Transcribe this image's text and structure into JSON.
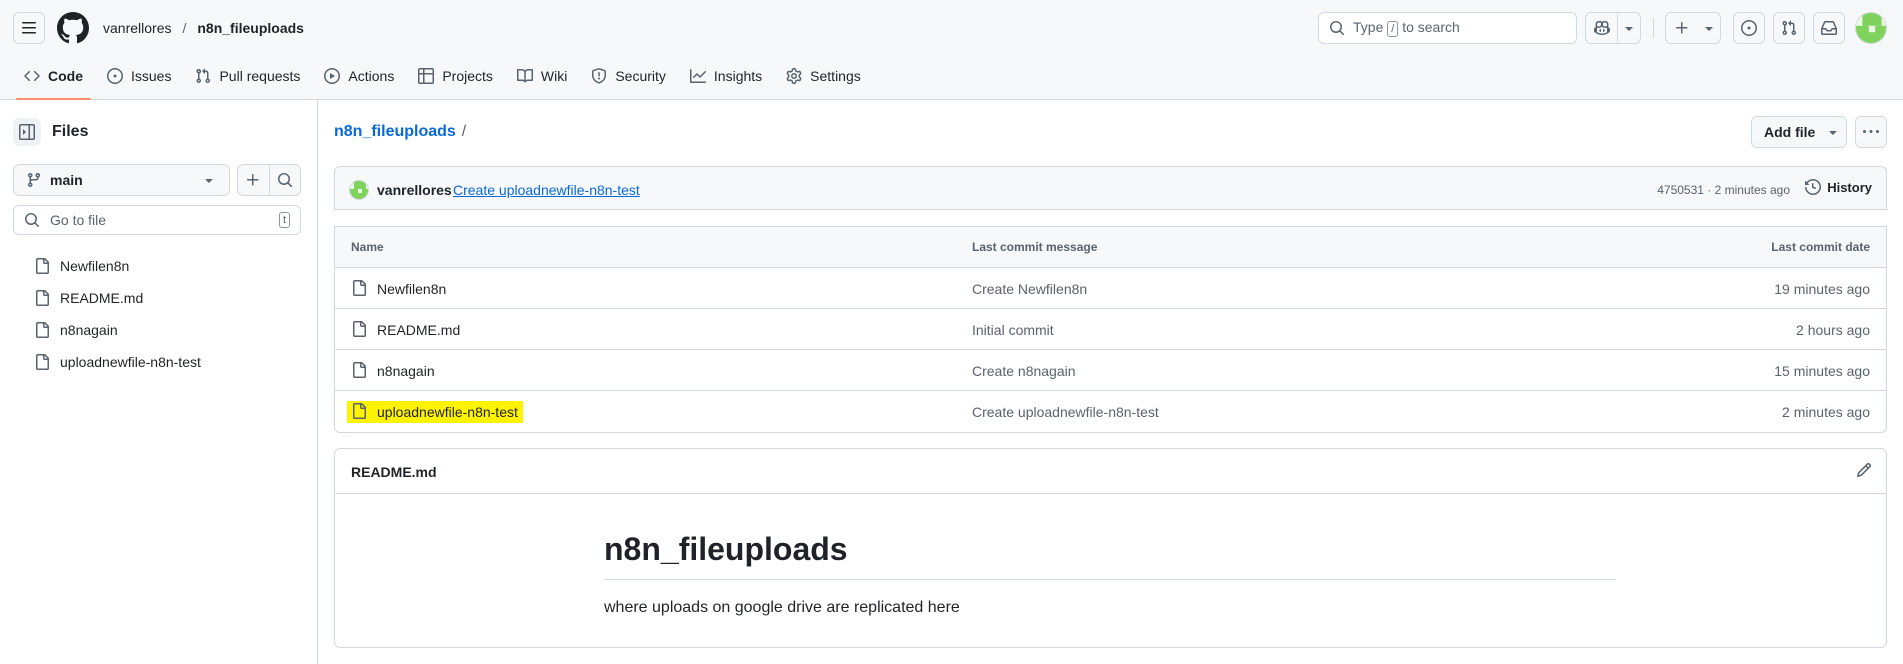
{
  "header": {
    "owner": "vanrellores",
    "separator": "/",
    "repo": "n8n_fileuploads",
    "search": {
      "text_before": "Type",
      "key": "/",
      "text_after": "to search"
    }
  },
  "tabs": [
    {
      "label": "Code",
      "icon": "code-icon",
      "active": true
    },
    {
      "label": "Issues",
      "icon": "issue-opened-icon"
    },
    {
      "label": "Pull requests",
      "icon": "git-pull-request-icon"
    },
    {
      "label": "Actions",
      "icon": "play-icon"
    },
    {
      "label": "Projects",
      "icon": "table-icon"
    },
    {
      "label": "Wiki",
      "icon": "book-icon"
    },
    {
      "label": "Security",
      "icon": "shield-icon"
    },
    {
      "label": "Insights",
      "icon": "graph-icon"
    },
    {
      "label": "Settings",
      "icon": "gear-icon"
    }
  ],
  "sidebar": {
    "title": "Files",
    "branch": "main",
    "goto_placeholder": "Go to file",
    "goto_key": "t",
    "files": [
      "Newfilen8n",
      "README.md",
      "n8nagain",
      "uploadnewfile-n8n-test"
    ]
  },
  "main": {
    "repo_link": "n8n_fileuploads",
    "repo_slash": "/",
    "add_file_label": "Add file",
    "latest_commit": {
      "author": "vanrellores",
      "message": "Create uploadnewfile-n8n-test",
      "meta": "4750531 · 2 minutes ago",
      "history_label": "History"
    },
    "table": {
      "headers": {
        "name": "Name",
        "message": "Last commit message",
        "date": "Last commit date"
      },
      "rows": [
        {
          "name": "Newfilen8n",
          "message": "Create Newfilen8n",
          "date": "19 minutes ago"
        },
        {
          "name": "README.md",
          "message": "Initial commit",
          "date": "2 hours ago"
        },
        {
          "name": "n8nagain",
          "message": "Create n8nagain",
          "date": "15 minutes ago"
        },
        {
          "name": "uploadnewfile-n8n-test",
          "message": "Create uploadnewfile-n8n-test",
          "date": "2 minutes ago",
          "highlight_color": "#fff300"
        }
      ]
    },
    "readme": {
      "file_title": "README.md",
      "heading": "n8n_fileuploads",
      "paragraph": "where uploads on google drive are replicated here"
    }
  },
  "colors": {
    "accent_link": "#0969da",
    "tab_underline": "#fd8c73",
    "highlight": "#fff300",
    "avatar_green": "#7fd25c"
  }
}
